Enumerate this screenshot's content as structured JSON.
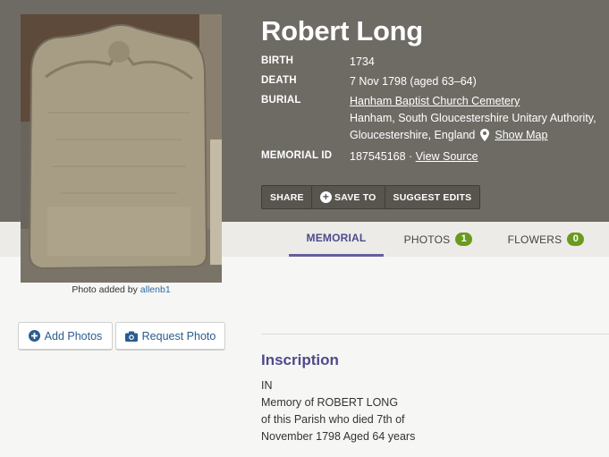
{
  "person": {
    "name": "Robert Long"
  },
  "facts": {
    "birth_label": "BIRTH",
    "birth_value": "1734",
    "death_label": "DEATH",
    "death_value": "7 Nov 1798 (aged 63–64)",
    "burial_label": "BURIAL",
    "cemetery_link": "Hanham Baptist Church Cemetery",
    "location_line1": "Hanham, South Gloucestershire Unitary Authority,",
    "location_line2": "Gloucestershire, England",
    "show_map": "Show Map",
    "memorial_label": "MEMORIAL ID",
    "memorial_value": "187545168 ·",
    "view_source": "View Source"
  },
  "actions": {
    "share": "SHARE",
    "save_to": "SAVE TO",
    "suggest_edits": "SUGGEST EDITS"
  },
  "photo": {
    "caption_prefix": "Photo added by",
    "caption_user": "allenb1"
  },
  "tabs": {
    "memorial": "MEMORIAL",
    "photos": "PHOTOS",
    "photos_count": "1",
    "flowers": "FLOWERS",
    "flowers_count": "0"
  },
  "sidebar": {
    "add_photos": "Add Photos",
    "request_photo": "Request Photo"
  },
  "inscription": {
    "title": "Inscription",
    "lines": [
      "IN",
      "Memory of ROBERT LONG",
      "of this Parish who died 7th of",
      "November 1798 Aged 64 years"
    ]
  },
  "colors": {
    "hero_bg": "#6e6b65",
    "accent_purple": "#4e4a8c",
    "badge_green": "#6a9a1f",
    "link_blue": "#2f6aa3"
  },
  "icons": [
    "map-pin-icon",
    "plus-circle-icon",
    "camera-icon"
  ]
}
